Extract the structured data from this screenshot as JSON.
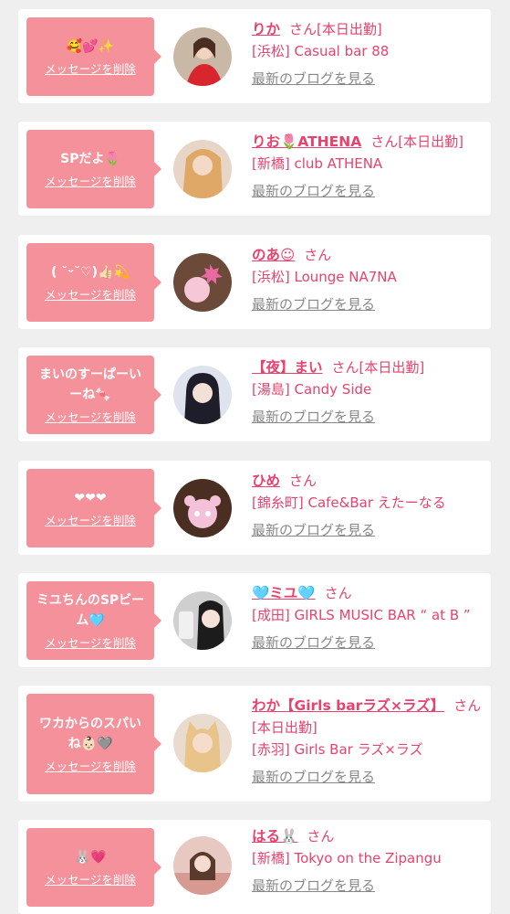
{
  "delete_label": "メッセージを削除",
  "blog_label": "最新のブログを見る",
  "san_label": "さん",
  "colors": {
    "accent": "#e8426d",
    "bubble": "#f5919a",
    "background": "#efefef"
  },
  "cards": [
    {
      "message": "🥰💕✨",
      "name": "りか",
      "status": "[本日出勤]",
      "shop": "[浜松] Casual bar 88",
      "avatar_icon": "photo-red-dress"
    },
    {
      "message": "SPだよ🌷",
      "name": "りお🌷ATHENA",
      "status": "[本日出勤]",
      "shop": "[新橋] club ATHENA",
      "avatar_icon": "photo-blonde"
    },
    {
      "message": "( ˘ᵕ˘♡)👍🏻💫",
      "name": "のあ☺︎",
      "status": "",
      "shop": "[浜松] Lounge NA7NA",
      "avatar_icon": "photo-heart-sticker"
    },
    {
      "message": "まいのすーぱーいーね🍬",
      "name": "【夜】まい",
      "status": "[本日出勤]",
      "shop": "[湯島] Candy Side",
      "avatar_icon": "photo-dark-hair"
    },
    {
      "message": "❤︎❤︎❤︎",
      "name": "ひめ",
      "status": "",
      "shop": "[錦糸町] Cafe&Bar えたーなる",
      "avatar_icon": "photo-panda-sticker"
    },
    {
      "message": "ミユちんのSPビーム🩵",
      "name": "🩵ミユ🩵",
      "status": "",
      "shop": "[成田] GIRLS MUSIC BAR “ at B ”",
      "avatar_icon": "photo-selfie"
    },
    {
      "message": "ワカからのスパいね👶🏻🩶",
      "name": "わか【Girls barラズ×ラズ】",
      "status": "[本日出勤]",
      "shop": "[赤羽] Girls Bar ラズ×ラズ",
      "avatar_icon": "photo-cat-ears"
    },
    {
      "message": "🐰💗",
      "name": "はる🐰",
      "status": "",
      "shop": "[新橋] Tokyo on the Zipangu",
      "avatar_icon": "photo-cafe"
    }
  ]
}
